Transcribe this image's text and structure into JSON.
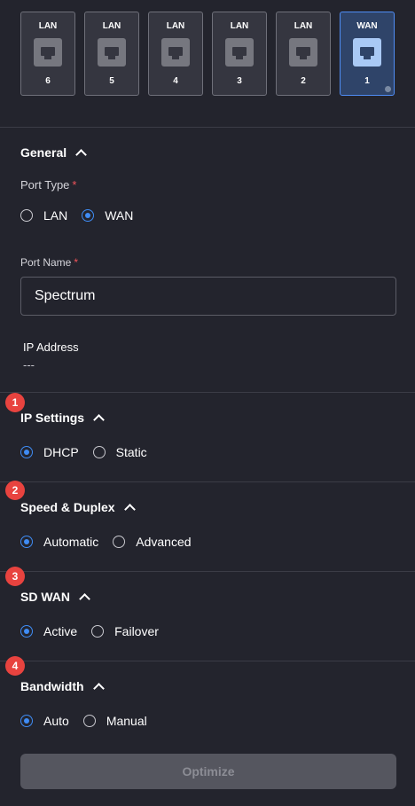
{
  "ports": [
    {
      "type": "LAN",
      "number": "6",
      "active": false
    },
    {
      "type": "LAN",
      "number": "5",
      "active": false
    },
    {
      "type": "LAN",
      "number": "4",
      "active": false
    },
    {
      "type": "LAN",
      "number": "3",
      "active": false
    },
    {
      "type": "LAN",
      "number": "2",
      "active": false
    },
    {
      "type": "WAN",
      "number": "1",
      "active": true
    }
  ],
  "general": {
    "title": "General",
    "port_type_label": "Port Type",
    "required_mark": "*",
    "port_type_options": [
      "LAN",
      "WAN"
    ],
    "port_type_selected": "WAN",
    "port_name_label": "Port Name",
    "port_name_value": "Spectrum",
    "ip_address_label": "IP Address",
    "ip_address_value": "---"
  },
  "ip_settings": {
    "badge": "1",
    "title": "IP Settings",
    "options": [
      "DHCP",
      "Static"
    ],
    "selected": "DHCP"
  },
  "speed_duplex": {
    "badge": "2",
    "title": "Speed & Duplex",
    "options": [
      "Automatic",
      "Advanced"
    ],
    "selected": "Automatic"
  },
  "sd_wan": {
    "badge": "3",
    "title": "SD WAN",
    "options": [
      "Active",
      "Failover"
    ],
    "selected": "Active"
  },
  "bandwidth": {
    "badge": "4",
    "title": "Bandwidth",
    "options": [
      "Auto",
      "Manual"
    ],
    "selected": "Auto"
  },
  "optimize_button": "Optimize",
  "colors": {
    "background": "#23242d",
    "accent": "#3f8cf5",
    "badge": "#e8433f",
    "required": "#f2545b"
  }
}
